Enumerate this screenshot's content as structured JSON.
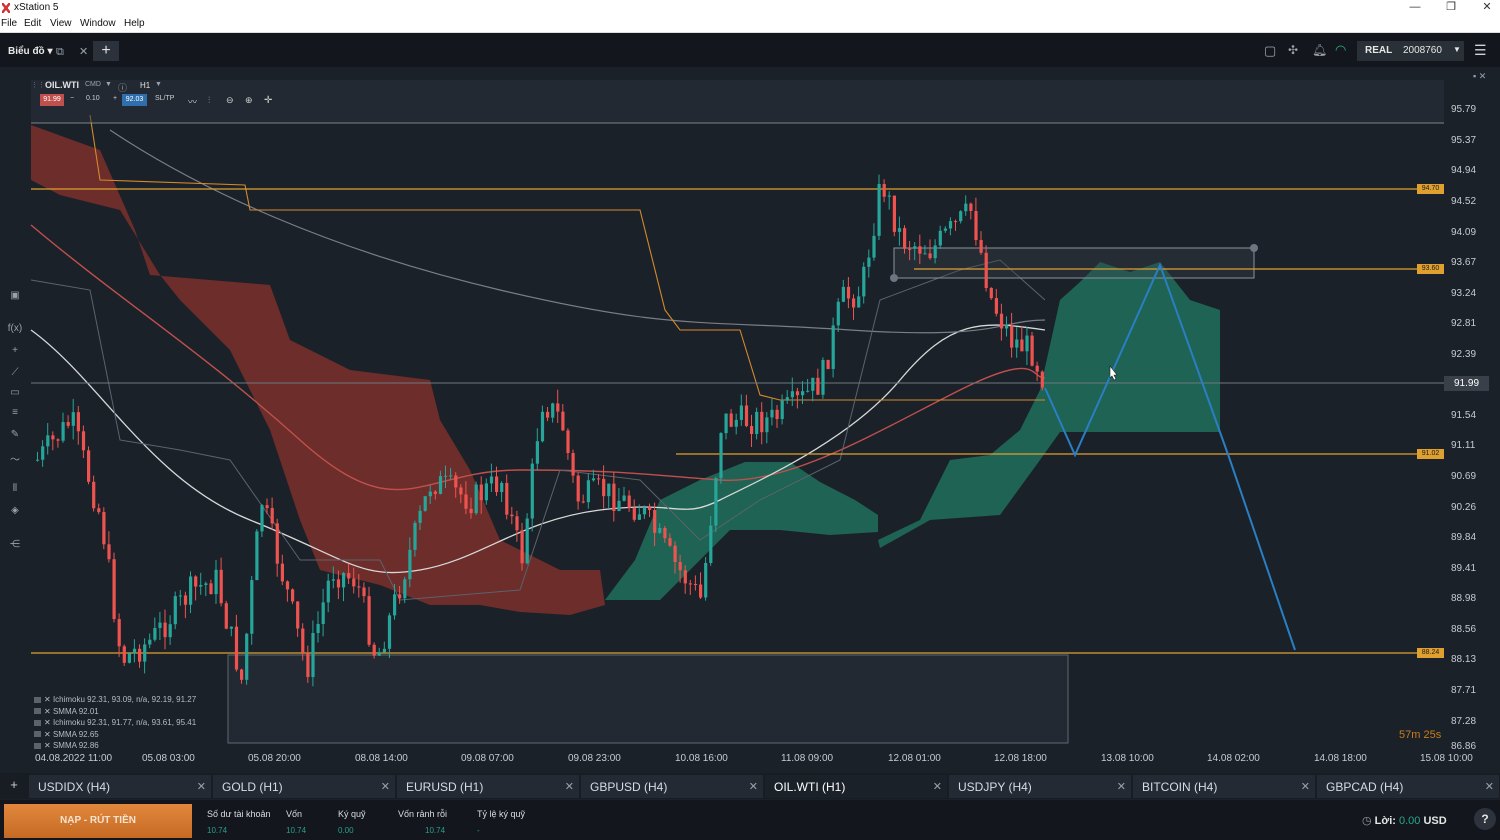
{
  "window": {
    "title": "xStation 5",
    "minimize": "—",
    "restore": "❐",
    "close": "✕"
  },
  "menu": [
    "File",
    "Edit",
    "View",
    "Window",
    "Help"
  ],
  "toolbar": {
    "tab_label": "Biểu đồ",
    "add_label": "+"
  },
  "account": {
    "mode": "REAL",
    "number": "2008760"
  },
  "chart_header": {
    "symbol": "OIL.WTI",
    "type": "CMD",
    "timeframe": "H1",
    "bid": "91.99",
    "volume": "0.10",
    "ask": "92.03",
    "sltp": "SL/TP"
  },
  "chart_data": {
    "type": "candlestick",
    "symbol": "OIL.WTI",
    "timeframe": "H1",
    "y_ticks": [
      "95.79",
      "95.37",
      "94.94",
      "94.52",
      "94.09",
      "93.67",
      "93.24",
      "92.81",
      "92.39",
      "91.99",
      "91.54",
      "91.11",
      "90.69",
      "90.26",
      "89.84",
      "89.41",
      "88.98",
      "88.56",
      "88.13",
      "87.71",
      "87.28",
      "86.86"
    ],
    "x_ticks": [
      "04.08.2022 11:00",
      "05.08 03:00",
      "05.08 20:00",
      "08.08 14:00",
      "09.08 07:00",
      "09.08 23:00",
      "10.08 16:00",
      "11.08 09:00",
      "12.08 01:00",
      "12.08 18:00",
      "13.08 10:00",
      "14.08 02:00",
      "14.08 18:00",
      "15.08 10:00"
    ],
    "current_price": "91.99",
    "horizontal_levels": [
      "94.70",
      "93.60",
      "91.02",
      "88.24"
    ],
    "countdown": "57m 25s",
    "indicators": [
      "Ichimoku 92.31, 93.09, n/a, 92.19, 91.27",
      "SMMA 92.01",
      "Ichimoku 92.31, 91.77, n/a, 93.61, 95.41",
      "SMMA 92.65",
      "SMMA 92.86"
    ]
  },
  "tabs": [
    {
      "label": "USDIDX (H4)",
      "active": false
    },
    {
      "label": "GOLD (H1)",
      "active": false
    },
    {
      "label": "EURUSD (H1)",
      "active": false
    },
    {
      "label": "GBPUSD (H4)",
      "active": false
    },
    {
      "label": "OIL.WTI (H1)",
      "active": true
    },
    {
      "label": "USDJPY (H4)",
      "active": false
    },
    {
      "label": "BITCOIN (H4)",
      "active": false
    },
    {
      "label": "GBPCAD (H4)",
      "active": false
    }
  ],
  "footer": {
    "deposit_label": "NẠP - RÚT TIỀN",
    "balance_label": "Số dư tài khoản",
    "balance_value": "10.74",
    "equity_label": "Vốn",
    "equity_value": "10.74",
    "margin_label": "Ký quỹ",
    "margin_value": "0.00",
    "free_margin_label": "Vốn rảnh rỗi",
    "free_margin_value": "10.74",
    "margin_level_label": "Tỷ lệ ký quỹ",
    "margin_level_value": "-",
    "profit_label": "Lời:",
    "profit_value": "0.00",
    "currency": "USD",
    "help": "?"
  },
  "colors": {
    "bull": "#26a69a",
    "bear": "#ef5350",
    "level": "#e0a030",
    "cloud_bull": "#1e6f5c",
    "cloud_bear": "#7a2f2c",
    "projection": "#2a7fc4"
  }
}
